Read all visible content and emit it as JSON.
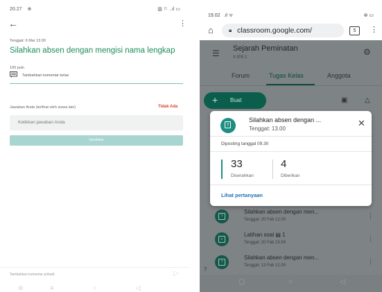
{
  "left": {
    "status": {
      "time": "20.27",
      "icons_left": "⊕",
      "icons_right": "▥ ⚐ ..ıl ▭"
    },
    "back_icon": "arrow-left-icon",
    "due": "Tenggat: 6 Mar 13.00",
    "title": "Silahkan absen dengan mengisi nama lengkap",
    "points": "100 poin",
    "class_comment": "Tambahkan komentar kelas",
    "answer_label": "Jawaban Anda (terlihat oleh siswa lain)",
    "missing": "Tidak Ada",
    "answer_placeholder": "Ketikkan jawaban Anda",
    "submit_label": "Serahkan",
    "private_comment": "Tambahkan komentar pribadi",
    "colors": {
      "title": "#1e8e5a",
      "missing": "#d14a2a",
      "submit": "#a8d5d0"
    }
  },
  "right": {
    "status": {
      "time": "19.02",
      "icons_left": ".ıl ᯤ",
      "icons_right": "⊛ ▭"
    },
    "url": "classroom.google.com/",
    "tab_count": "5",
    "class_name": "Sejarah Peminatan",
    "section": "X IPS 1",
    "tabs": [
      {
        "label": "Forum"
      },
      {
        "label": "Tugas Kelas"
      },
      {
        "label": "Anggota"
      }
    ],
    "create_label": "Buat",
    "popup": {
      "title": "Silahkan absen dengan ...",
      "due": "Tenggat: 13.00",
      "posted": "Diposting tanggal 09.30",
      "submitted_count": "33",
      "submitted_label": "Diserahkan",
      "assigned_count": "4",
      "assigned_label": "Diberikan",
      "link": "Lihat pertanyaan"
    },
    "items": [
      {
        "title": "Silahkan absen dengan men...",
        "due": "Tenggat: 20 Feb 12.00"
      },
      {
        "title": "Latihan soal  ▤ 1",
        "due": "Tenggat: 20 Feb 23.59"
      },
      {
        "title": "Silahkan absen dengan men...",
        "due": "Tenggat: 13 Feb 12.00"
      }
    ],
    "colors": {
      "accent": "#0c5e4c",
      "link": "#1a6fb5",
      "icon": "#1e8e82"
    }
  }
}
